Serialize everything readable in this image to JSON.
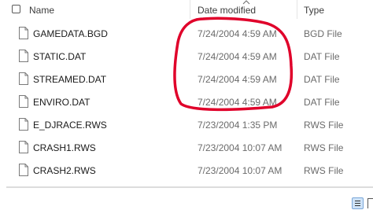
{
  "header": {
    "name_label": "Name",
    "date_label": "Date modified",
    "type_label": "Type"
  },
  "files": [
    {
      "name": "GAMEDATA.BGD",
      "date": "7/24/2004 4:59 AM",
      "type": "BGD File"
    },
    {
      "name": "STATIC.DAT",
      "date": "7/24/2004 4:59 AM",
      "type": "DAT File"
    },
    {
      "name": "STREAMED.DAT",
      "date": "7/24/2004 4:59 AM",
      "type": "DAT File"
    },
    {
      "name": "ENVIRO.DAT",
      "date": "7/24/2004 4:59 AM",
      "type": "DAT File"
    },
    {
      "name": "E_DJRACE.RWS",
      "date": "7/23/2004 1:35 PM",
      "type": "RWS File"
    },
    {
      "name": "CRASH1.RWS",
      "date": "7/23/2004 10:07 AM",
      "type": "RWS File"
    },
    {
      "name": "CRASH2.RWS",
      "date": "7/23/2004 10:07 AM",
      "type": "RWS File"
    }
  ],
  "annotation": {
    "color": "#e0002a"
  },
  "icons": {
    "file": "document-icon",
    "view_details": "details-view-icon",
    "view_tiles": "tiles-view-icon"
  }
}
